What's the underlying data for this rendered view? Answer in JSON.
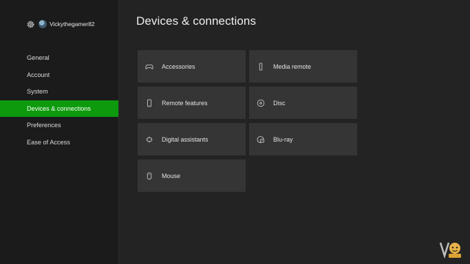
{
  "profile": {
    "username": "Vickythegamer82",
    "icon": "gear-icon"
  },
  "sidebar": {
    "items": [
      {
        "label": "General",
        "active": false
      },
      {
        "label": "Account",
        "active": false
      },
      {
        "label": "System",
        "active": false
      },
      {
        "label": "Devices & connections",
        "active": true
      },
      {
        "label": "Preferences",
        "active": false
      },
      {
        "label": "Ease of Access",
        "active": false
      }
    ]
  },
  "page": {
    "title": "Devices & connections"
  },
  "tiles": [
    {
      "label": "Accessories",
      "icon": "gamepad-icon"
    },
    {
      "label": "Media remote",
      "icon": "remote-icon"
    },
    {
      "label": "Remote features",
      "icon": "phone-icon"
    },
    {
      "label": "Disc",
      "icon": "disc-icon"
    },
    {
      "label": "Digital assistants",
      "icon": "assistant-icon"
    },
    {
      "label": "Blu-ray",
      "icon": "bluray-icon"
    },
    {
      "label": "Mouse",
      "icon": "mouse-icon"
    }
  ],
  "colors": {
    "accent": "#0d9a0d",
    "background": "#232323",
    "sidebar": "#1b1b1b",
    "tile": "#353535"
  }
}
